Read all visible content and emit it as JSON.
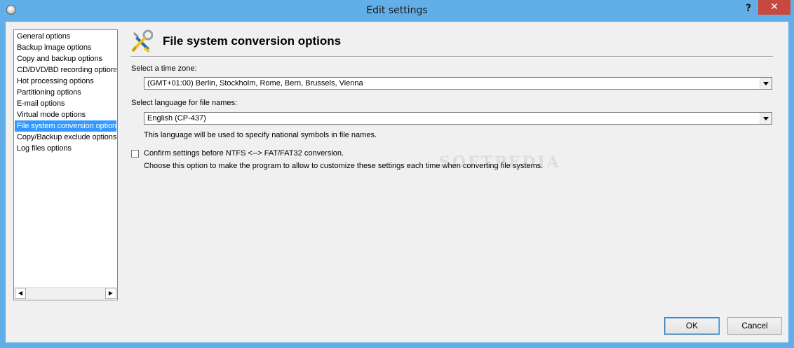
{
  "window": {
    "title": "Edit settings",
    "help_label": "?",
    "close_label": "✕"
  },
  "sidebar": {
    "items": [
      {
        "label": "General options"
      },
      {
        "label": "Backup image options"
      },
      {
        "label": "Copy and backup options"
      },
      {
        "label": "CD/DVD/BD recording options"
      },
      {
        "label": "Hot processing options"
      },
      {
        "label": "Partitioning options"
      },
      {
        "label": "E-mail options"
      },
      {
        "label": "Virtual mode options"
      },
      {
        "label": "File system conversion options",
        "selected": true
      },
      {
        "label": "Copy/Backup exclude options"
      },
      {
        "label": "Log files options"
      }
    ],
    "scroll_left": "◀",
    "scroll_right": "▶"
  },
  "page": {
    "title": "File system conversion options",
    "timezone_label": "Select a time zone:",
    "timezone_value": "(GMT+01:00) Berlin, Stockholm, Rome, Bern, Brussels, Vienna",
    "language_label": "Select language for file names:",
    "language_value": "English (CP-437)",
    "language_hint": "This language will be used to specify national symbols in file names.",
    "confirm_label": "Confirm settings before NTFS <--> FAT/FAT32 conversion.",
    "confirm_checked": false,
    "confirm_hint": "Choose this option to make the program to allow to customize these settings each time when converting file systems."
  },
  "watermark": "SOFTPEDIA",
  "buttons": {
    "ok": "OK",
    "cancel": "Cancel"
  },
  "colors": {
    "titlebar": "#62aee8",
    "close": "#c7483f",
    "selection": "#3399ff"
  }
}
